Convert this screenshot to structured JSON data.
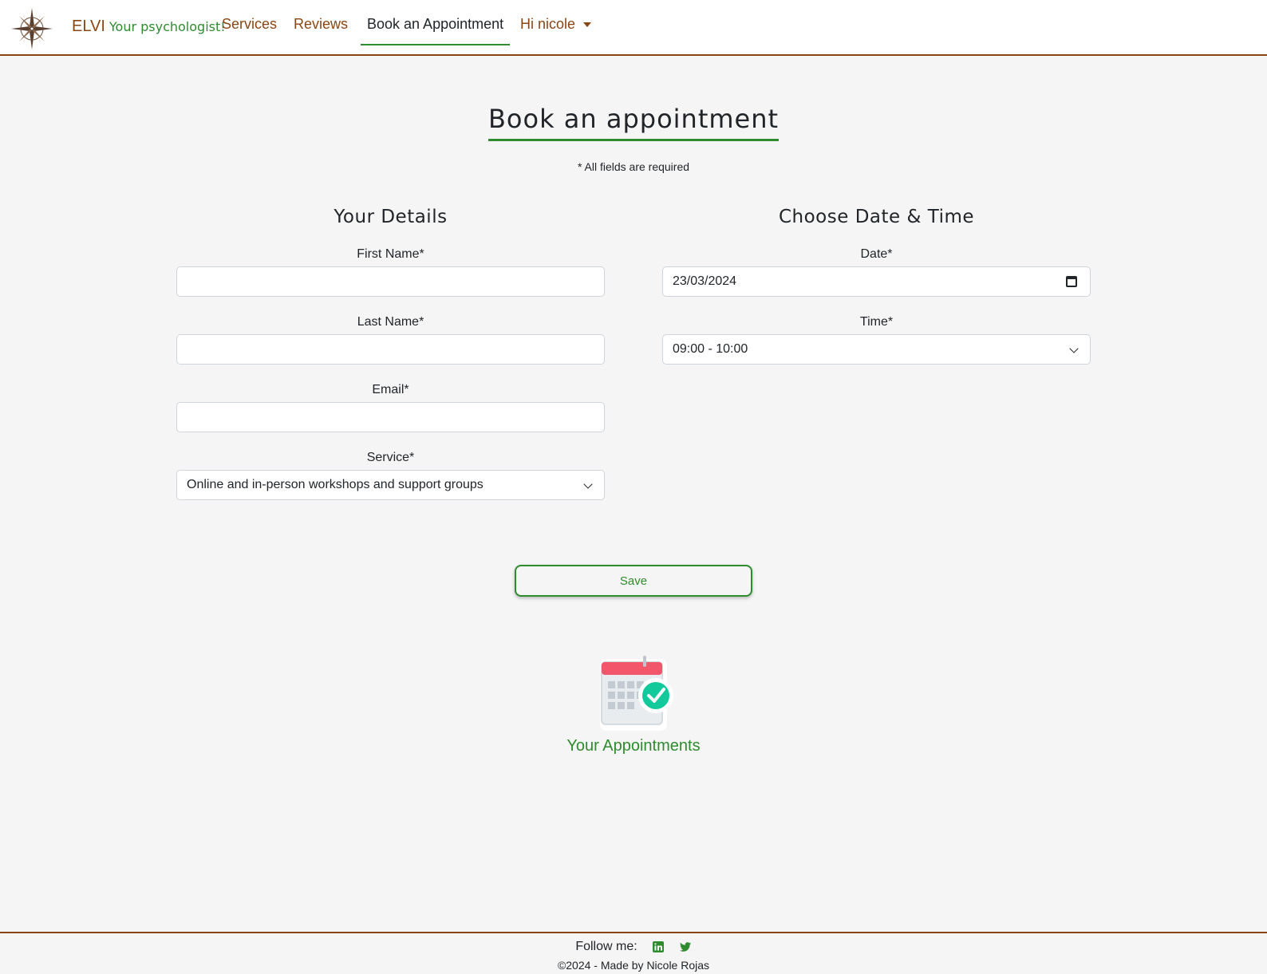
{
  "navbar": {
    "brand_name": "ELVI",
    "brand_tagline": "Your psychologist!",
    "links": {
      "services": "Services",
      "reviews": "Reviews",
      "book": "Book an Appointment",
      "user": "Hi nicole"
    },
    "active_link": "Book an Appointment"
  },
  "main": {
    "title": "Book an appointment",
    "required_note": "* All fields are required",
    "details": {
      "heading": "Your Details",
      "first_name_label": "First Name*",
      "first_name_value": "",
      "last_name_label": "Last Name*",
      "last_name_value": "",
      "email_label": "Email*",
      "email_value": "",
      "service_label": "Service*",
      "service_value": "Online and in-person workshops and support groups"
    },
    "datetime": {
      "heading": "Choose Date & Time",
      "date_label": "Date*",
      "date_value": "23/03/2024",
      "time_label": "Time*",
      "time_value": "09:00 - 10:00"
    },
    "save_label": "Save",
    "appointments_label": "Your Appointments"
  },
  "footer": {
    "follow_label": "Follow me:",
    "copyright": "©2024 - Made by Nicole Rojas"
  },
  "colors": {
    "brand_brown": "#8b4513",
    "accent_green": "#2e8b2e",
    "background": "#f5f5f5"
  },
  "icons": {
    "logo": "compass-rose-icon",
    "appointments": "calendar-check-icon",
    "social": [
      "linkedin-icon",
      "twitter-icon"
    ]
  }
}
